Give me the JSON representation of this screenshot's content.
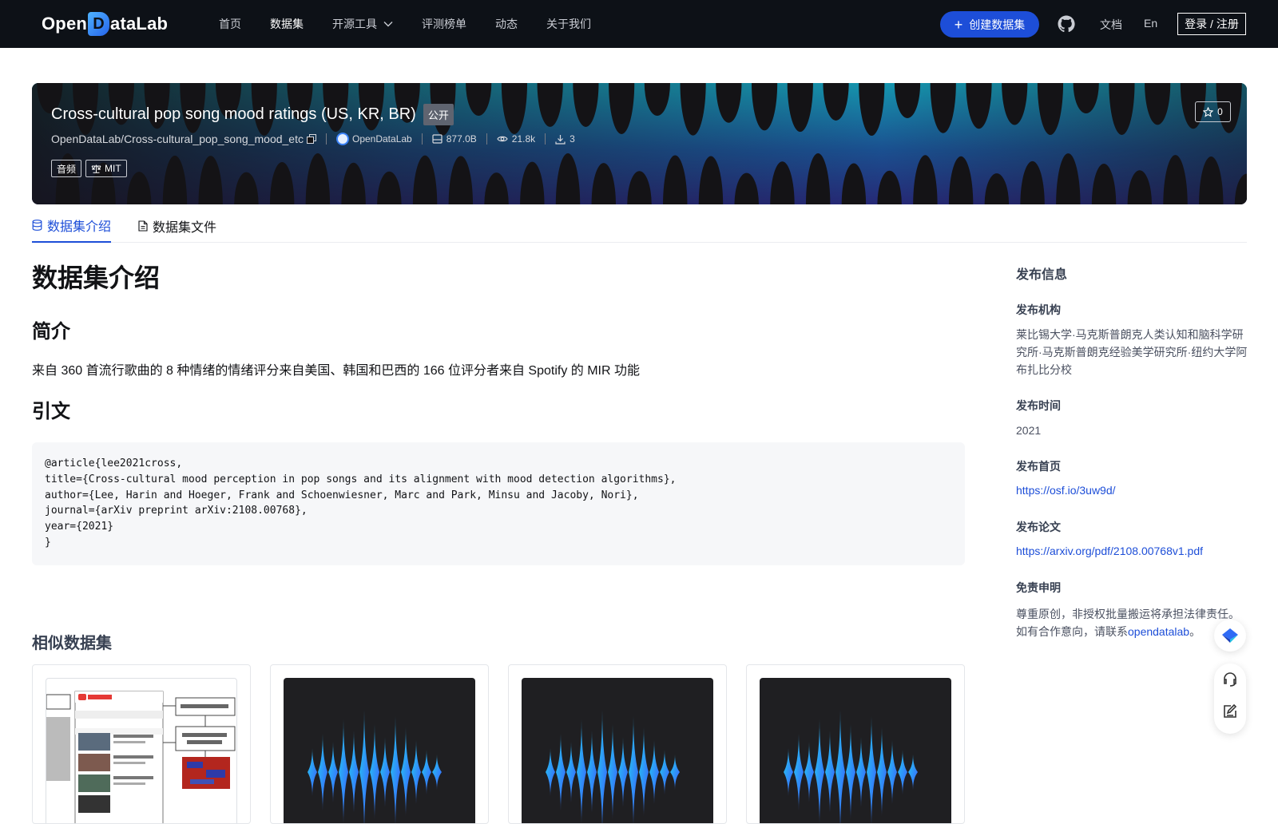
{
  "nav": {
    "logo": {
      "left": "Open",
      "mark": "D",
      "right": "ataLab"
    },
    "links": [
      {
        "label": "首页",
        "active": false
      },
      {
        "label": "数据集",
        "active": true
      },
      {
        "label": "开源工具",
        "active": false,
        "has_dropdown": true
      },
      {
        "label": "评测榜单",
        "active": false
      },
      {
        "label": "动态",
        "active": false
      },
      {
        "label": "关于我们",
        "active": false
      }
    ],
    "create_button": "创建数据集",
    "docs": "文档",
    "lang": "En",
    "login": "登录 / 注册"
  },
  "dataset": {
    "title": "Cross-cultural pop song mood ratings (US, KR, BR)",
    "visibility": "公开",
    "repo": "OpenDataLab/Cross-cultural_pop_song_mood_etc",
    "org": "OpenDataLab",
    "size": "877.0B",
    "views": "21.8k",
    "downloads": "3",
    "tags": [
      "音频",
      "MIT"
    ],
    "stars": "0"
  },
  "tabs": [
    {
      "label": "数据集介绍",
      "icon": "database-icon",
      "active": true
    },
    {
      "label": "数据集文件",
      "icon": "file-icon",
      "active": false
    }
  ],
  "content": {
    "heading": "数据集介绍",
    "intro_heading": "简介",
    "intro_text": "来自 360 首流行歌曲的 8 种情绪的情绪评分来自美国、韩国和巴西的 166 位评分者来自 Spotify 的 MIR 功能",
    "citation_heading": "引文",
    "citation": "@article{lee2021cross,\ntitle={Cross-cultural mood perception in pop songs and its alignment with mood detection algorithms},\nauthor={Lee, Harin and Hoeger, Frank and Schoenwiesner, Marc and Park, Minsu and Jacoby, Nori},\njournal={arXiv preprint arXiv:2108.00768},\nyear={2021}\n}",
    "similar_heading": "相似数据集"
  },
  "similar_cards": [
    {
      "thumb": "diagram"
    },
    {
      "thumb": "waveform"
    },
    {
      "thumb": "waveform"
    },
    {
      "thumb": "waveform"
    }
  ],
  "sidebar": {
    "title": "发布信息",
    "org_label": "发布机构",
    "org_value": "莱比锡大学·马克斯普朗克人类认知和脑科学研究所·马克斯普朗克经验美学研究所·纽约大学阿布扎比分校",
    "time_label": "发布时间",
    "time_value": "2021",
    "home_label": "发布首页",
    "home_value": "https://osf.io/3uw9d/",
    "paper_label": "发布论文",
    "paper_value": "https://arxiv.org/pdf/2108.00768v1.pdf",
    "disclaimer_label": "免责申明",
    "disclaimer_text_1": "尊重原创，非授权批量搬运将承担法律责任。",
    "disclaimer_text_2": "如有合作意向，请联系",
    "disclaimer_link": "opendatalab",
    "disclaimer_end": "。"
  },
  "colors": {
    "primary": "#1d4ed8",
    "nav_bg": "#0d1117",
    "banner_bg": "#141316"
  }
}
